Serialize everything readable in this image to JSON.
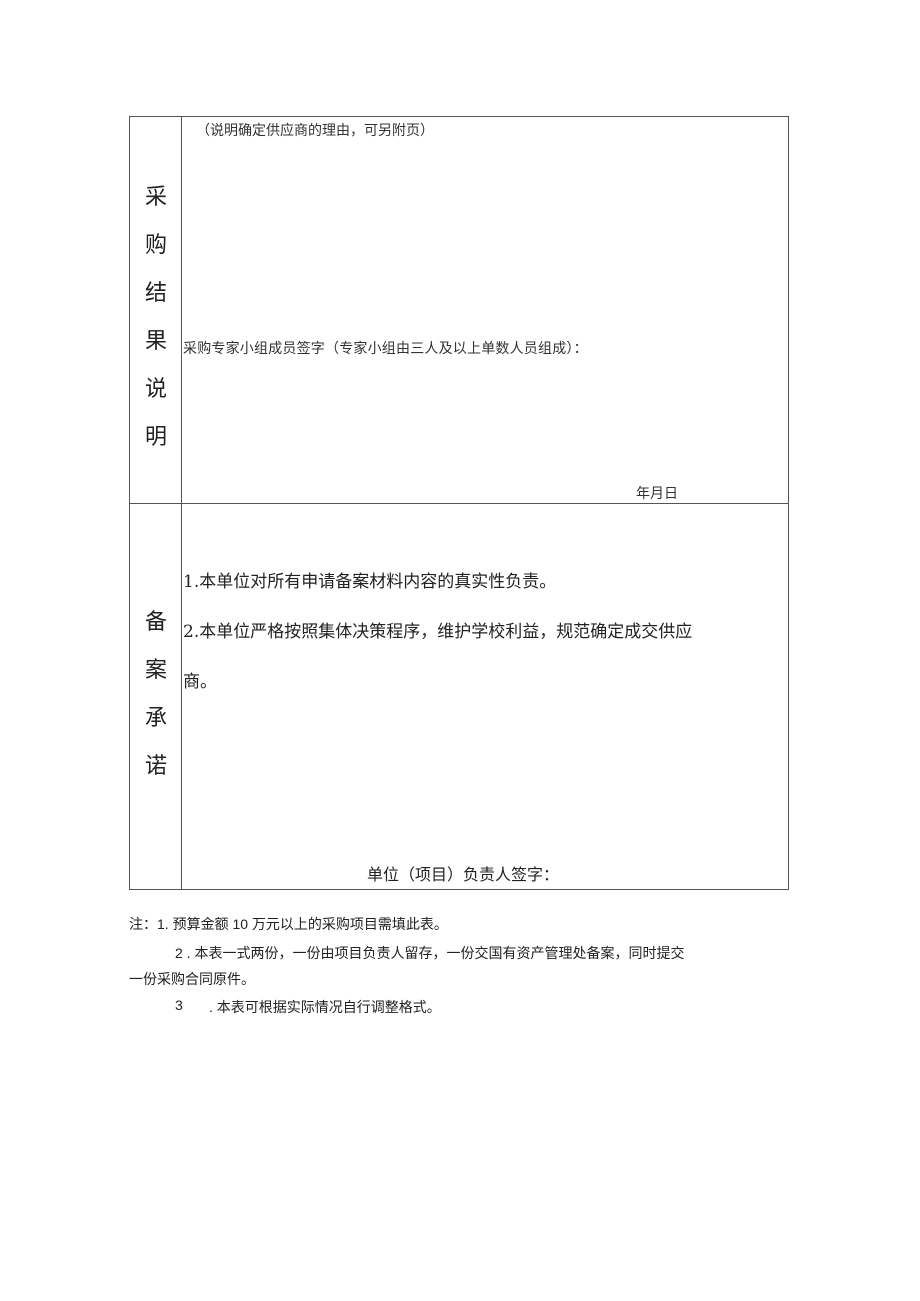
{
  "table": {
    "result_section": {
      "label_chars": [
        "采",
        "购",
        "结",
        "果",
        "说",
        "明"
      ],
      "instruction": "（说明确定供应商的理由，可另附页）",
      "expert_sign_label": "采购专家小组成员签字（专家小组由三人及以上单数人员组成）：",
      "date_label": "年月日"
    },
    "commitment_section": {
      "label_chars": [
        "备",
        "案",
        "承",
        "诺"
      ],
      "item1": "1.本单位对所有申请备案材料内容的真实性负责。",
      "item2_line1": "2.本单位严格按照集体决策程序，维护学校利益，规范确定成交供应",
      "item2_line2": "商。",
      "leader_sign_label": "单位（项目）负责人签字："
    }
  },
  "notes": {
    "line1": "注：1. 预算金额 10 万元以上的采购项目需填此表。",
    "line2_part1": "2 . 本表一式两份，一份由项目负责人留存，一份交国有资产管理处备案，同时提交",
    "line2_part2": "一份采购合同原件。",
    "line3_number": "3",
    "line3_text": ". 本表可根据实际情况自行调整格式。"
  }
}
